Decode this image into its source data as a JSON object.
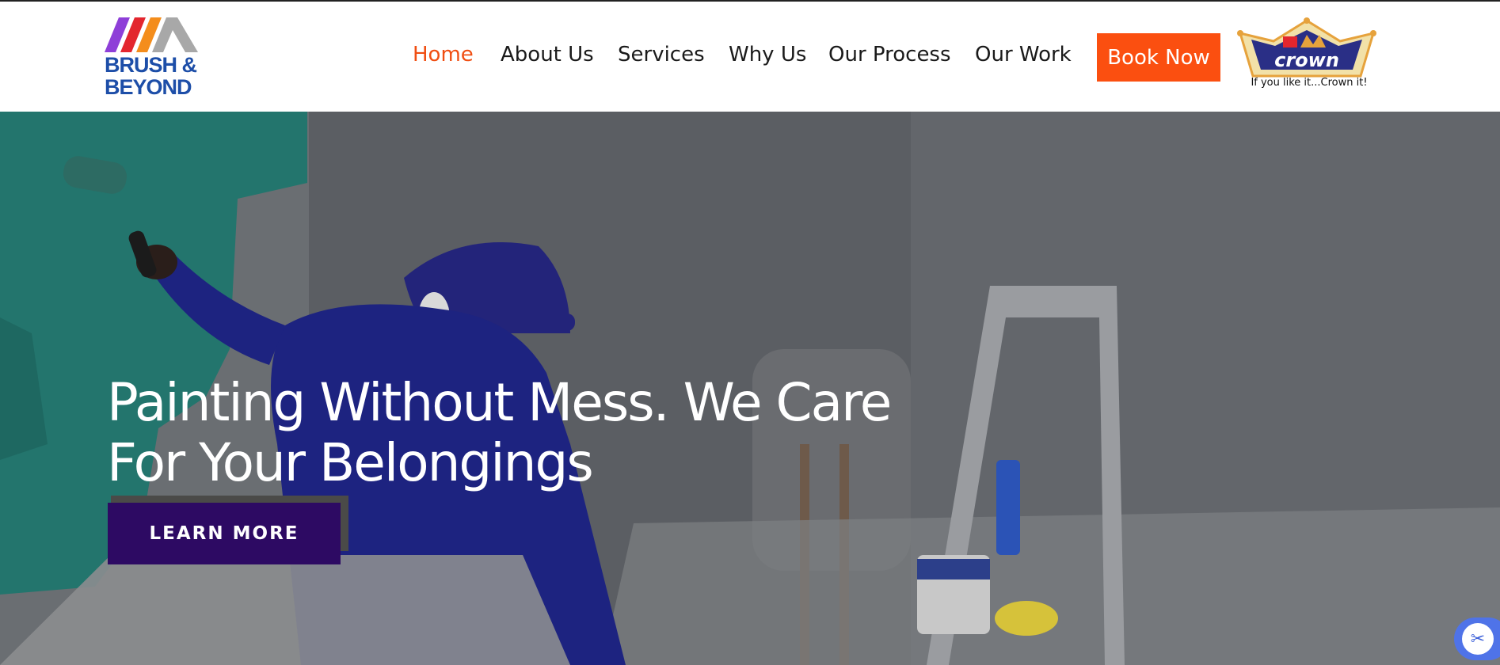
{
  "brand": {
    "logo_line1": "BRUSH &",
    "logo_line2": "BEYOND",
    "stripe_colors": [
      "#8e3fd8",
      "#e3262e",
      "#f48d1c",
      "#a8a8a8"
    ]
  },
  "nav": {
    "items": [
      {
        "label": "Home",
        "active": true
      },
      {
        "label": "About Us",
        "active": false
      },
      {
        "label": "Services",
        "active": false
      },
      {
        "label": "Why Us",
        "active": false
      },
      {
        "label": "Our Process",
        "active": false
      },
      {
        "label": "Our Work",
        "active": false
      }
    ],
    "book_label": "Book Now"
  },
  "partner": {
    "name": "crown",
    "tagline": "If you like it...Crown it!"
  },
  "hero": {
    "title_line1": "Painting Without Mess. We Care",
    "title_line2": "For Your Belongings",
    "cta_label": "LEARN MORE"
  },
  "side_widget": {
    "icon": "scissors-icon"
  },
  "colors": {
    "accent_orange": "#fb4f10",
    "nav_active": "#f04e12",
    "cta_purple": "#2d0a63",
    "brand_blue": "#1d4ea8",
    "widget_blue": "#4f73e8"
  }
}
